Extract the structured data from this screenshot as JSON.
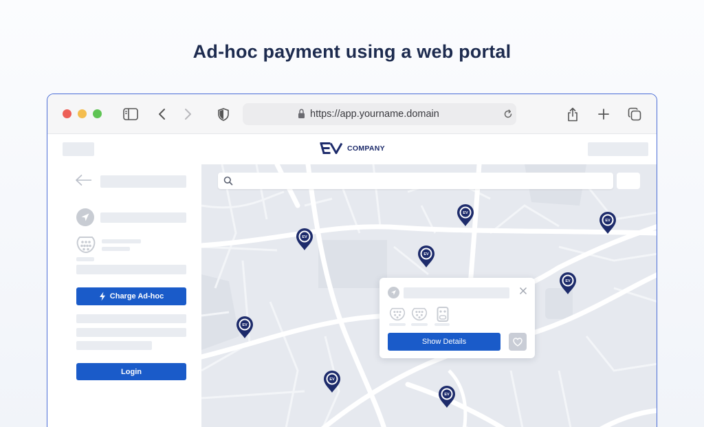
{
  "headline": "Ad-hoc payment using a web portal",
  "browser": {
    "url": "https://app.yourname.domain",
    "toolbar_icons": [
      "sidebar-icon",
      "back-icon",
      "forward-icon",
      "shield-icon",
      "lock-icon",
      "reload-icon",
      "share-icon",
      "new-tab-icon",
      "tabs-icon"
    ]
  },
  "site": {
    "logo_mark": "EV",
    "logo_text": "COMPANY"
  },
  "sidebar": {
    "charge_button_label": "Charge Ad-hoc",
    "login_button_label": "Login"
  },
  "map": {
    "pin_label": "EV",
    "popup": {
      "show_details_label": "Show Details"
    }
  },
  "colors": {
    "brand_blue": "#1a5bc9",
    "navy": "#1d2b6b",
    "placeholder_gray": "#e9ecf1"
  }
}
